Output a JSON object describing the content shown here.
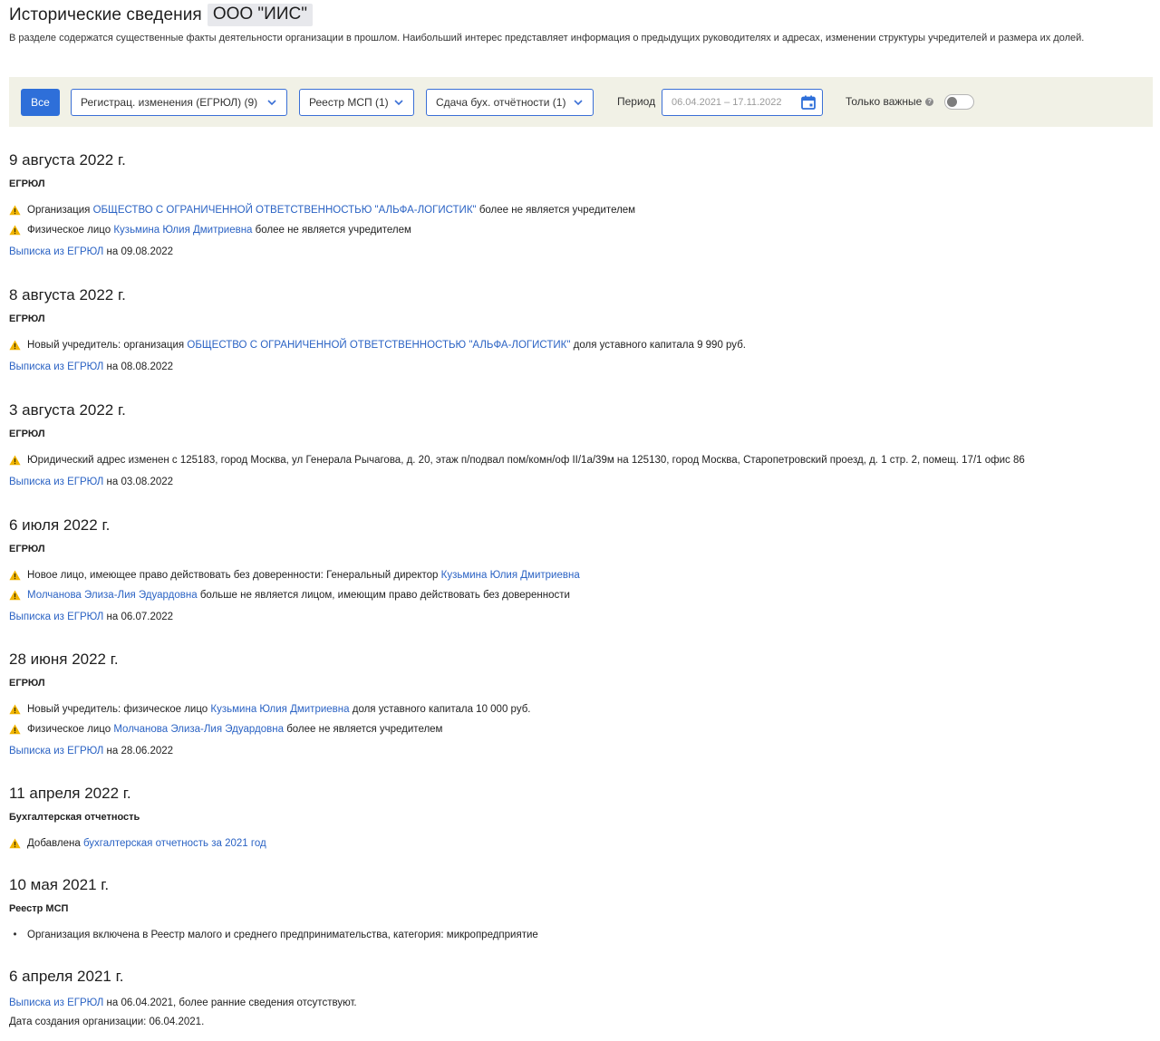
{
  "header": {
    "title": "Исторические сведения",
    "org": "ООО \"ИИС\"",
    "intro": "В разделе содержатся существенные факты деятельности организации в прошлом. Наибольший интерес представляет информация о предыдущих руководителях и адресах, изменении структуры учредителей и размера их долей."
  },
  "filters": {
    "all": "Все",
    "dd1": "Регистрац. изменения (ЕГРЮЛ) (9)",
    "dd2": "Реестр МСП (1)",
    "dd3": "Сдача бух. отчётности (1)",
    "period_label": "Период",
    "period_value": "06.04.2021 – 17.11.2022",
    "important_label": "Только важные",
    "help": "?"
  },
  "colors": {
    "accent": "#2e6fd9",
    "warning": "#f0b400",
    "link": "#2b63c4",
    "filter_bg": "#f1f1e6"
  },
  "s1": {
    "date": "9 августа 2022 г.",
    "source": "ЕГРЮЛ",
    "i1": {
      "pre": "Организация",
      "link": "ОБЩЕСТВО С ОГРАНИЧЕННОЙ ОТВЕТСТВЕННОСТЬЮ \"АЛЬФА-ЛОГИСТИК\"",
      "post": "более не является учредителем"
    },
    "i2": {
      "pre": "Физическое лицо",
      "link": "Кузьмина Юлия Дмитриевна",
      "post": "более не является учредителем"
    },
    "ext_link": "Выписка из ЕГРЮЛ",
    "ext_text": "на 09.08.2022"
  },
  "s2": {
    "date": "8 августа 2022 г.",
    "source": "ЕГРЮЛ",
    "i1": {
      "pre": "Новый учредитель: организация",
      "link": "ОБЩЕСТВО С ОГРАНИЧЕННОЙ ОТВЕТСТВЕННОСТЬЮ \"АЛЬФА-ЛОГИСТИК\"",
      "post": "доля уставного капитала 9 990 руб."
    },
    "ext_link": "Выписка из ЕГРЮЛ",
    "ext_text": "на 08.08.2022"
  },
  "s3": {
    "date": "3 августа 2022 г.",
    "source": "ЕГРЮЛ",
    "i1": {
      "text": "Юридический адрес изменен с 125183, город Москва, ул Генерала Рычагова, д. 20, этаж п/подвал пом/комн/оф II/1а/39м на 125130, город Москва, Старопетровский проезд, д. 1 стр. 2, помещ. 17/1 офис 86"
    },
    "ext_link": "Выписка из ЕГРЮЛ",
    "ext_text": "на 03.08.2022"
  },
  "s4": {
    "date": "6 июля 2022 г.",
    "source": "ЕГРЮЛ",
    "i1": {
      "pre": "Новое лицо, имеющее право действовать без доверенности: Генеральный директор",
      "link": "Кузьмина Юлия Дмитриевна"
    },
    "i2": {
      "link": "Молчанова Элиза-Лия Эдуардовна",
      "post": "больше не является лицом, имеющим право действовать без доверенности"
    },
    "ext_link": "Выписка из ЕГРЮЛ",
    "ext_text": "на 06.07.2022"
  },
  "s5": {
    "date": "28 июня 2022 г.",
    "source": "ЕГРЮЛ",
    "i1": {
      "pre": "Новый учредитель: физическое лицо",
      "link": "Кузьмина Юлия Дмитриевна",
      "post": "доля уставного капитала 10 000 руб."
    },
    "i2": {
      "pre": "Физическое лицо",
      "link": "Молчанова Элиза-Лия Эдуардовна",
      "post": "более не является учредителем"
    },
    "ext_link": "Выписка из ЕГРЮЛ",
    "ext_text": "на 28.06.2022"
  },
  "s6": {
    "date": "11 апреля 2022 г.",
    "source": "Бухгалтерская отчетность",
    "i1": {
      "pre": "Добавлена",
      "link": "бухгалтерская отчетность за 2021 год"
    }
  },
  "s7": {
    "date": "10 мая 2021 г.",
    "source": "Реестр МСП",
    "bullet": "•",
    "i1": {
      "text": "Организация включена в Реестр малого и среднего предпринимательства, категория: микропредприятие"
    }
  },
  "s8": {
    "date": "6 апреля 2021 г.",
    "ext_link": "Выписка из ЕГРЮЛ",
    "ext_text": "на 06.04.2021, более ранние сведения отсутствуют.",
    "created": "Дата создания организации: 06.04.2021."
  }
}
